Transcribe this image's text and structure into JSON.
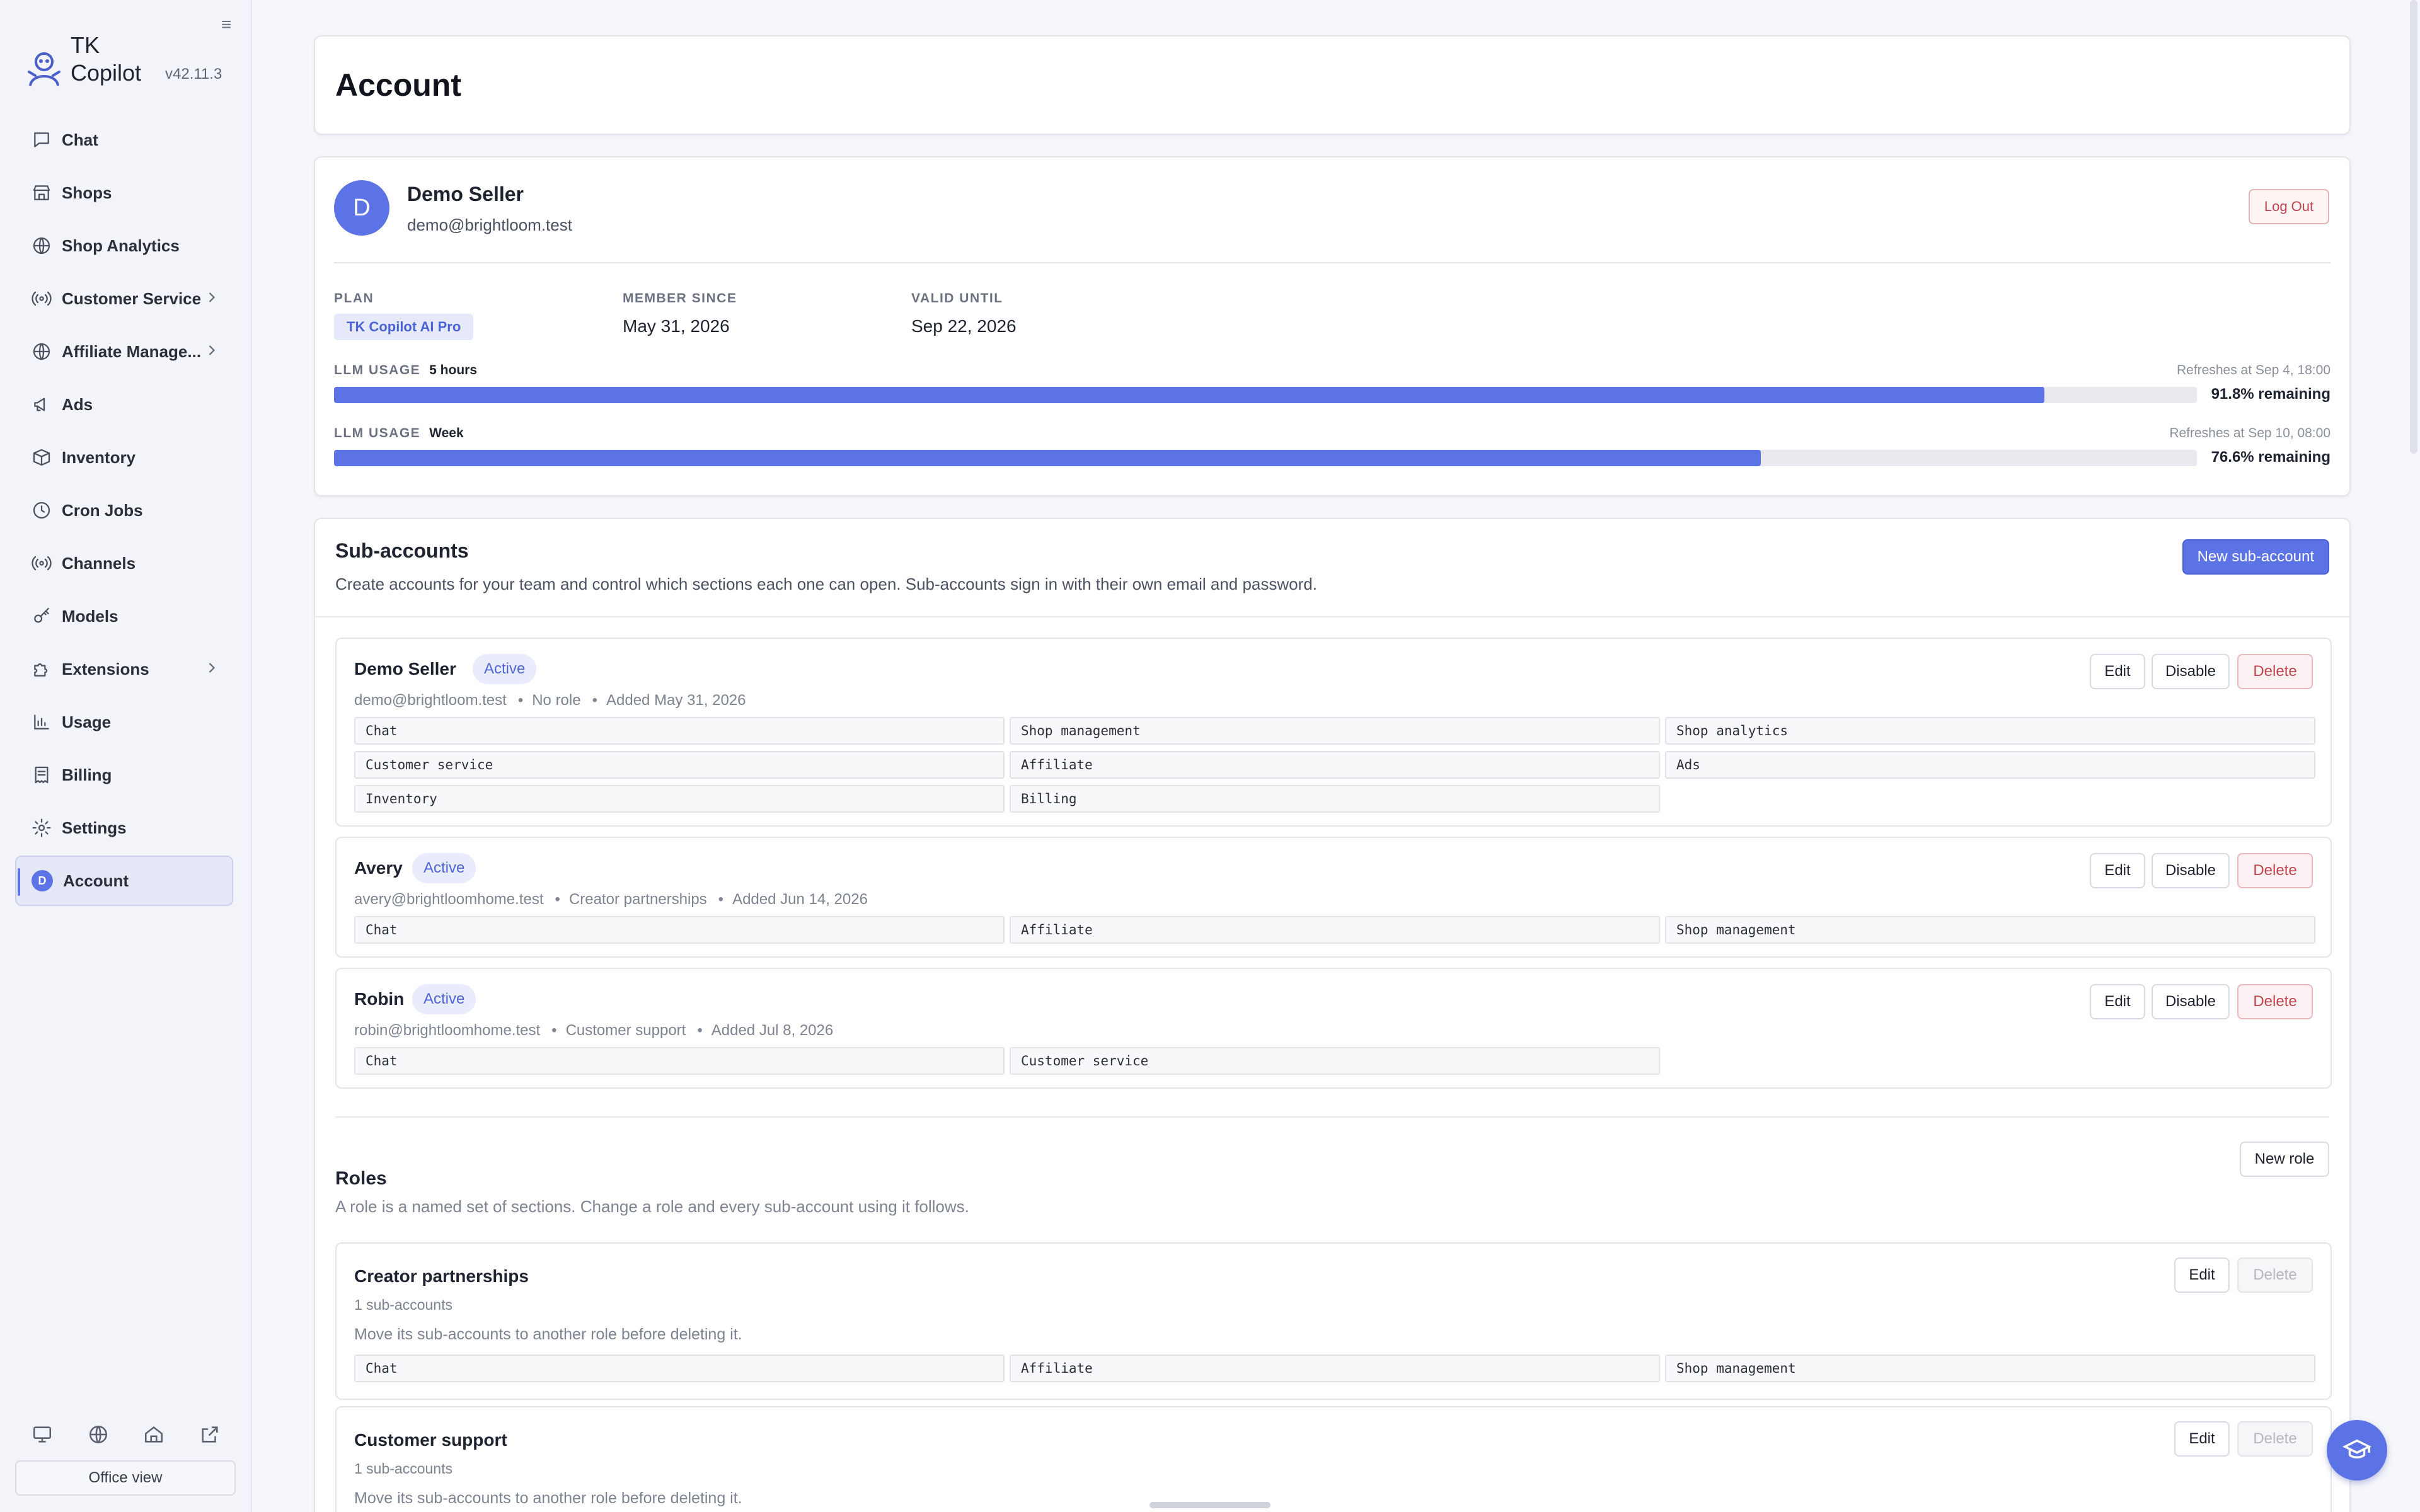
{
  "app": {
    "name": "TK Copilot",
    "version": "v42.11.3"
  },
  "sidebar": {
    "items": [
      {
        "label": "Chat",
        "icon": "chat-icon",
        "has_chevron": false
      },
      {
        "label": "Shops",
        "icon": "store-icon",
        "has_chevron": false
      },
      {
        "label": "Shop Analytics",
        "icon": "globe-icon",
        "has_chevron": false
      },
      {
        "label": "Customer Service",
        "icon": "broadcast-icon",
        "has_chevron": true
      },
      {
        "label": "Affiliate Manage...",
        "icon": "globe-icon",
        "has_chevron": true
      },
      {
        "label": "Ads",
        "icon": "megaphone-icon",
        "has_chevron": false
      },
      {
        "label": "Inventory",
        "icon": "box-icon",
        "has_chevron": false
      },
      {
        "label": "Cron Jobs",
        "icon": "clock-icon",
        "has_chevron": false
      },
      {
        "label": "Channels",
        "icon": "broadcast-icon",
        "has_chevron": false
      },
      {
        "label": "Models",
        "icon": "key-icon",
        "has_chevron": false
      },
      {
        "label": "Extensions",
        "icon": "puzzle-icon",
        "has_chevron": true
      },
      {
        "label": "Usage",
        "icon": "bar-chart-icon",
        "has_chevron": false
      },
      {
        "label": "Billing",
        "icon": "receipt-icon",
        "has_chevron": false
      },
      {
        "label": "Settings",
        "icon": "gear-icon",
        "has_chevron": false
      },
      {
        "label": "Account",
        "avatar": "D",
        "active": true
      }
    ],
    "office_view_label": "Office view"
  },
  "page": {
    "title": "Account"
  },
  "profile": {
    "avatar_letter": "D",
    "name": "Demo Seller",
    "email": "demo@brightloom.test",
    "logout_label": "Log Out",
    "plan_label": "PLAN",
    "plan_value": "TK Copilot AI Pro",
    "member_since_label": "MEMBER SINCE",
    "member_since_value": "May 31, 2026",
    "valid_until_label": "VALID UNTIL",
    "valid_until_value": "Sep 22, 2026",
    "usage": [
      {
        "label": "LLM USAGE",
        "window": "5 hours",
        "refresh": "Refreshes at Sep 4, 18:00",
        "remaining_pct": 91.8,
        "remaining_text": "91.8% remaining"
      },
      {
        "label": "LLM USAGE",
        "window": "Week",
        "refresh": "Refreshes at Sep 10, 08:00",
        "remaining_pct": 76.6,
        "remaining_text": "76.6% remaining"
      }
    ]
  },
  "subaccounts": {
    "title": "Sub-accounts",
    "description": "Create accounts for your team and control which sections each one can open. Sub-accounts sign in with their own email and password.",
    "new_label": "New sub-account",
    "edit_label": "Edit",
    "disable_label": "Disable",
    "delete_label": "Delete",
    "accounts": [
      {
        "name": "Demo Seller",
        "status": "Active",
        "email": "demo@brightloom.test",
        "role": "No role",
        "added": "Added May 31, 2026",
        "sections": [
          "Chat",
          "Shop management",
          "Shop analytics",
          "Customer service",
          "Affiliate",
          "Ads",
          "Inventory",
          "Billing"
        ]
      },
      {
        "name": "Avery",
        "status": "Active",
        "email": "avery@brightloomhome.test",
        "role": "Creator partnerships",
        "added": "Added Jun 14, 2026",
        "sections": [
          "Chat",
          "Affiliate",
          "Shop management"
        ]
      },
      {
        "name": "Robin",
        "status": "Active",
        "email": "robin@brightloomhome.test",
        "role": "Customer support",
        "added": "Added Jul 8, 2026",
        "sections": [
          "Chat",
          "Customer service"
        ]
      }
    ]
  },
  "roles": {
    "title": "Roles",
    "description": "A role is a named set of sections. Change a role and every sub-account using it follows.",
    "new_label": "New role",
    "edit_label": "Edit",
    "delete_label": "Delete",
    "items": [
      {
        "name": "Creator partnerships",
        "count": "1 sub-accounts",
        "note": "Move its sub-accounts to another role before deleting it.",
        "sections": [
          "Chat",
          "Affiliate",
          "Shop management"
        ]
      },
      {
        "name": "Customer support",
        "count": "1 sub-accounts",
        "note": "Move its sub-accounts to another role before deleting it.",
        "sections": []
      }
    ]
  }
}
